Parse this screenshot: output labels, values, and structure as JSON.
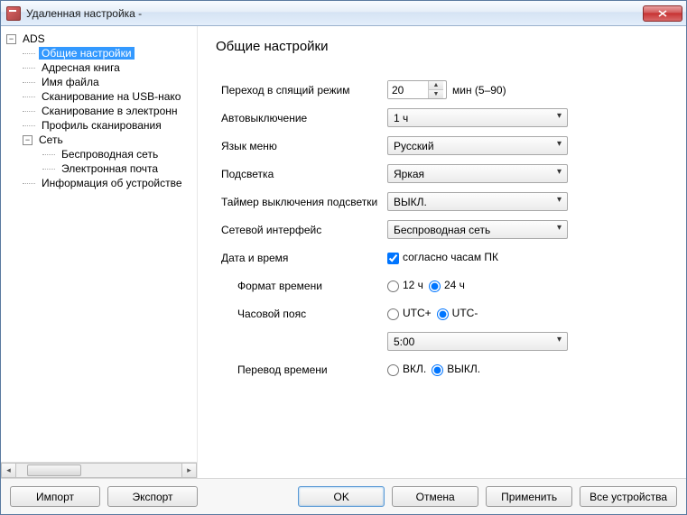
{
  "window": {
    "title": "Удаленная настройка -"
  },
  "tree": {
    "root": "ADS",
    "items": [
      "Общие настройки",
      "Адресная книга",
      "Имя файла",
      "Сканирование на USB-нако",
      "Сканирование в электронн",
      "Профиль сканирования"
    ],
    "network_label": "Сеть",
    "network_items": [
      "Беспроводная сеть",
      "Электронная почта"
    ],
    "info": "Информация об устройстве"
  },
  "page": {
    "heading": "Общие настройки",
    "sleep_label": "Переход в спящий режим",
    "sleep_value": "20",
    "sleep_suffix": "мин (5–90)",
    "autooff_label": "Автовыключение",
    "autooff_value": "1 ч",
    "lang_label": "Язык меню",
    "lang_value": "Русский",
    "backlight_label": "Подсветка",
    "backlight_value": "Яркая",
    "dimtimer_label": "Таймер выключения подсветки",
    "dimtimer_value": "ВЫКЛ.",
    "netif_label": "Сетевой интерфейс",
    "netif_value": "Беспроводная сеть",
    "datetime_label": "Дата и время",
    "pc_clock_label": "согласно часам ПК",
    "timefmt_label": "Формат времени",
    "timefmt_12": "12 ч",
    "timefmt_24": "24 ч",
    "tz_label": "Часовой пояс",
    "tz_utc_plus": "UTC+",
    "tz_utc_minus": "UTC-",
    "tz_offset": "5:00",
    "dst_label": "Перевод времени",
    "dst_on": "ВКЛ.",
    "dst_off": "ВЫКЛ."
  },
  "footer": {
    "import": "Импорт",
    "export": "Экспорт",
    "ok": "OK",
    "cancel": "Отмена",
    "apply": "Применить",
    "all_devices": "Все устройства"
  }
}
